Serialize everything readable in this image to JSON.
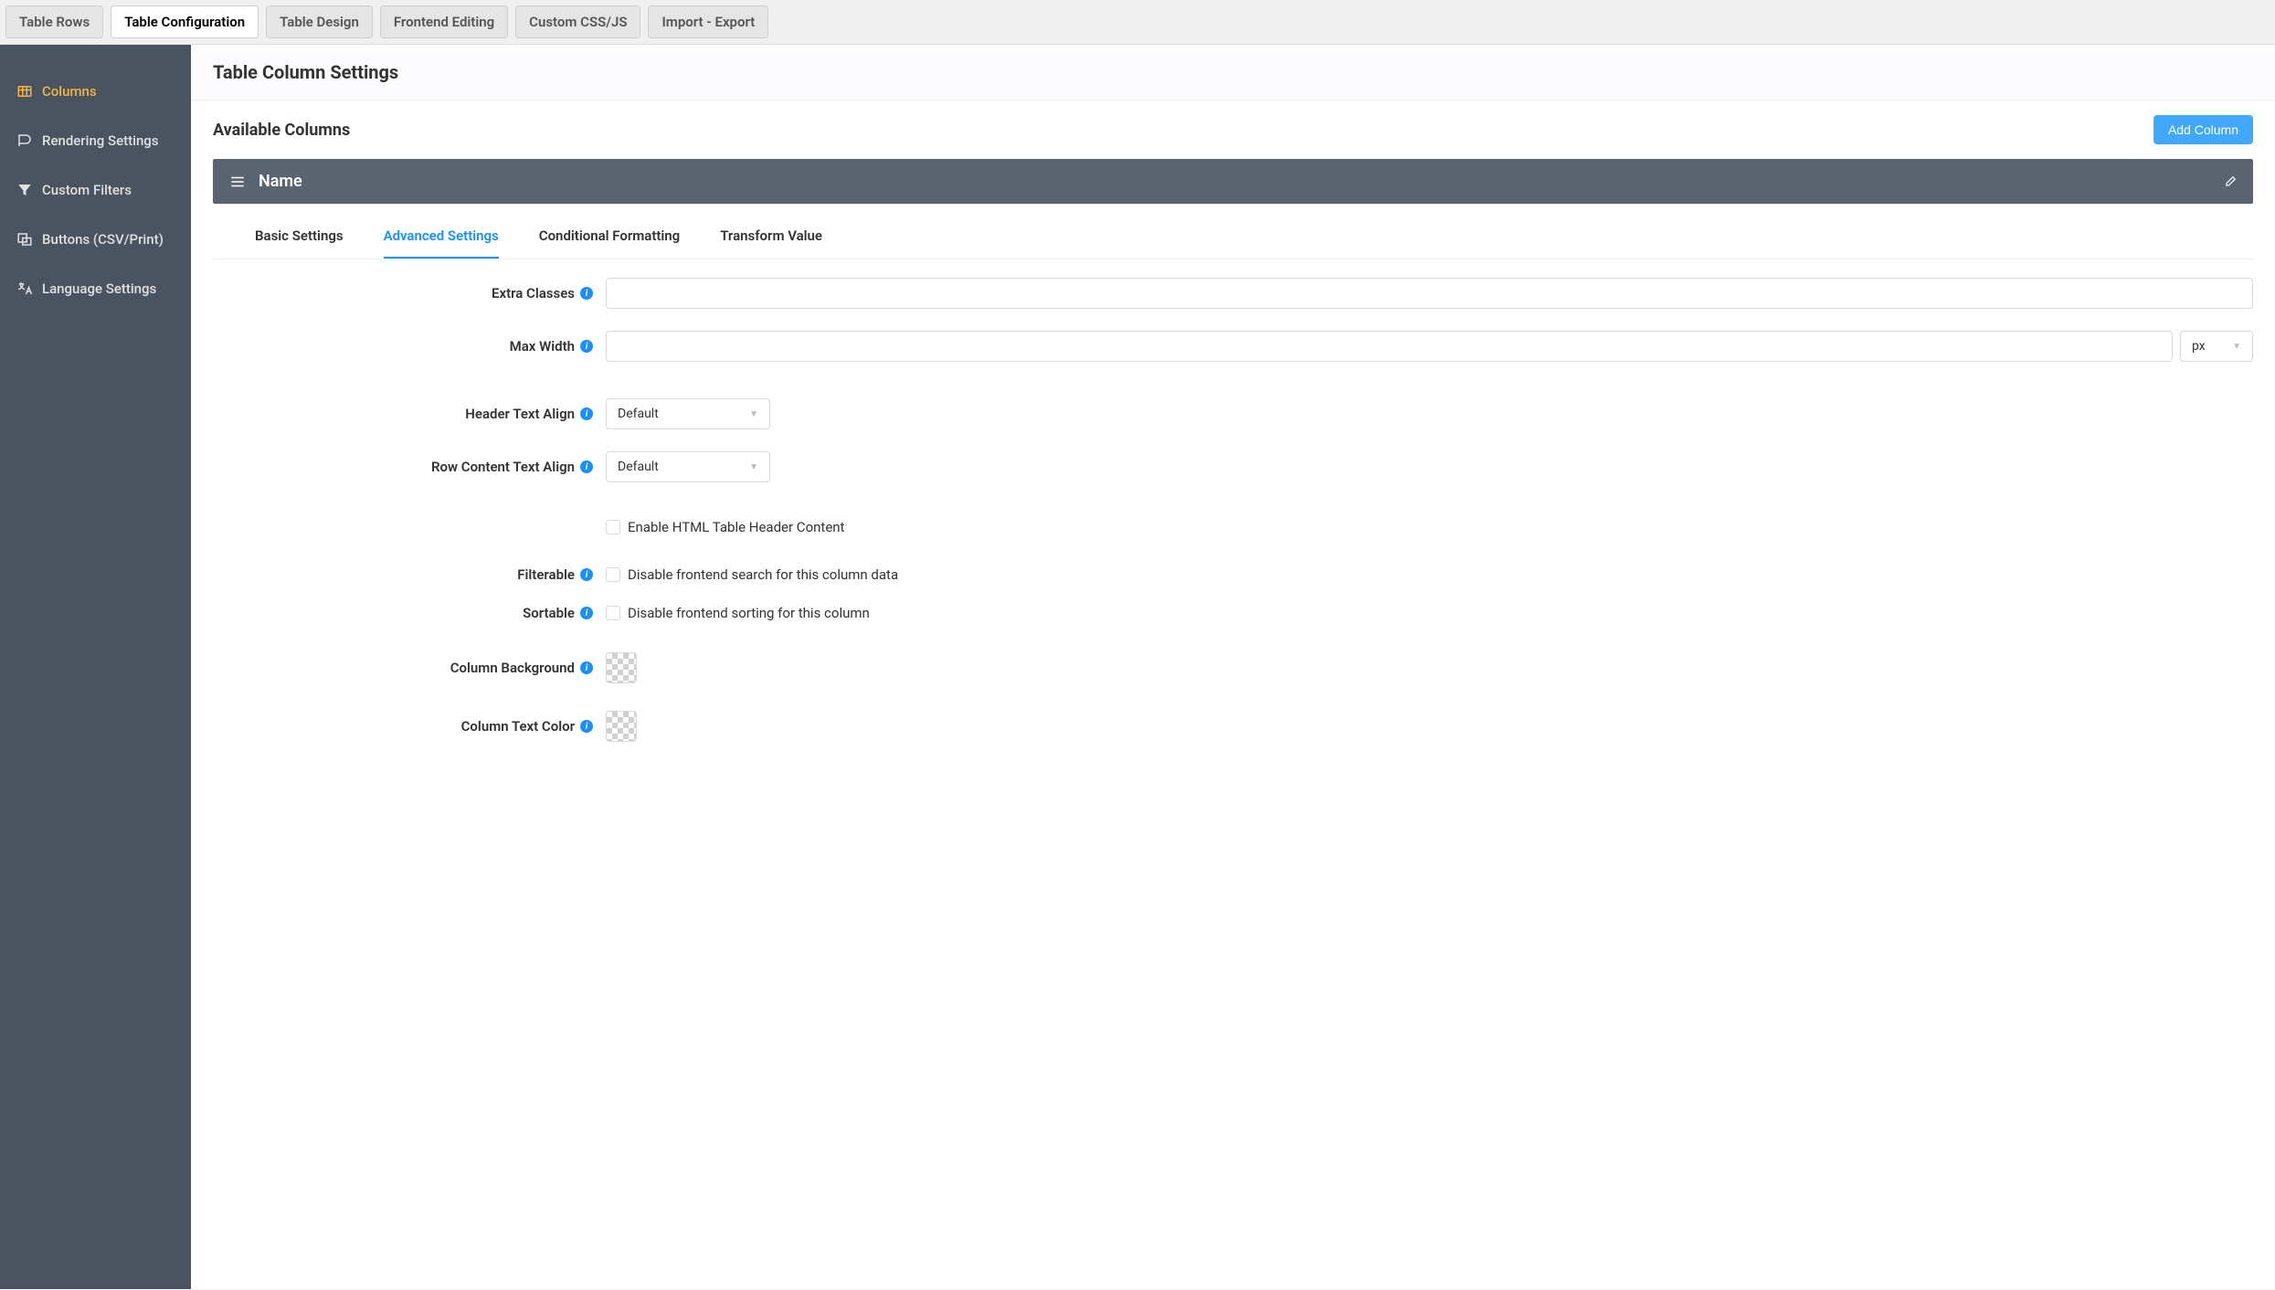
{
  "topTabs": [
    {
      "label": "Table Rows",
      "active": false
    },
    {
      "label": "Table Configuration",
      "active": true
    },
    {
      "label": "Table Design",
      "active": false
    },
    {
      "label": "Frontend Editing",
      "active": false
    },
    {
      "label": "Custom CSS/JS",
      "active": false
    },
    {
      "label": "Import - Export",
      "active": false
    }
  ],
  "sidebar": {
    "items": [
      {
        "label": "Columns",
        "active": true
      },
      {
        "label": "Rendering Settings",
        "active": false
      },
      {
        "label": "Custom Filters",
        "active": false
      },
      {
        "label": "Buttons (CSV/Print)",
        "active": false
      },
      {
        "label": "Language Settings",
        "active": false
      }
    ]
  },
  "main": {
    "pageTitle": "Table Column Settings",
    "sectionTitle": "Available Columns",
    "addButton": "Add Column",
    "columnName": "Name",
    "innerTabs": [
      {
        "label": "Basic Settings",
        "active": false
      },
      {
        "label": "Advanced Settings",
        "active": true
      },
      {
        "label": "Conditional Formatting",
        "active": false
      },
      {
        "label": "Transform Value",
        "active": false
      }
    ]
  },
  "form": {
    "extraClasses": {
      "label": "Extra Classes",
      "value": ""
    },
    "maxWidth": {
      "label": "Max Width",
      "value": "",
      "unit": "px"
    },
    "headerAlign": {
      "label": "Header Text Align",
      "value": "Default"
    },
    "rowAlign": {
      "label": "Row Content Text Align",
      "value": "Default"
    },
    "enableHtml": {
      "label": "Enable HTML Table Header Content"
    },
    "filterable": {
      "label": "Filterable",
      "checkLabel": "Disable frontend search for this column data"
    },
    "sortable": {
      "label": "Sortable",
      "checkLabel": "Disable frontend sorting for this column"
    },
    "columnBg": {
      "label": "Column Background"
    },
    "columnColor": {
      "label": "Column Text Color"
    }
  }
}
